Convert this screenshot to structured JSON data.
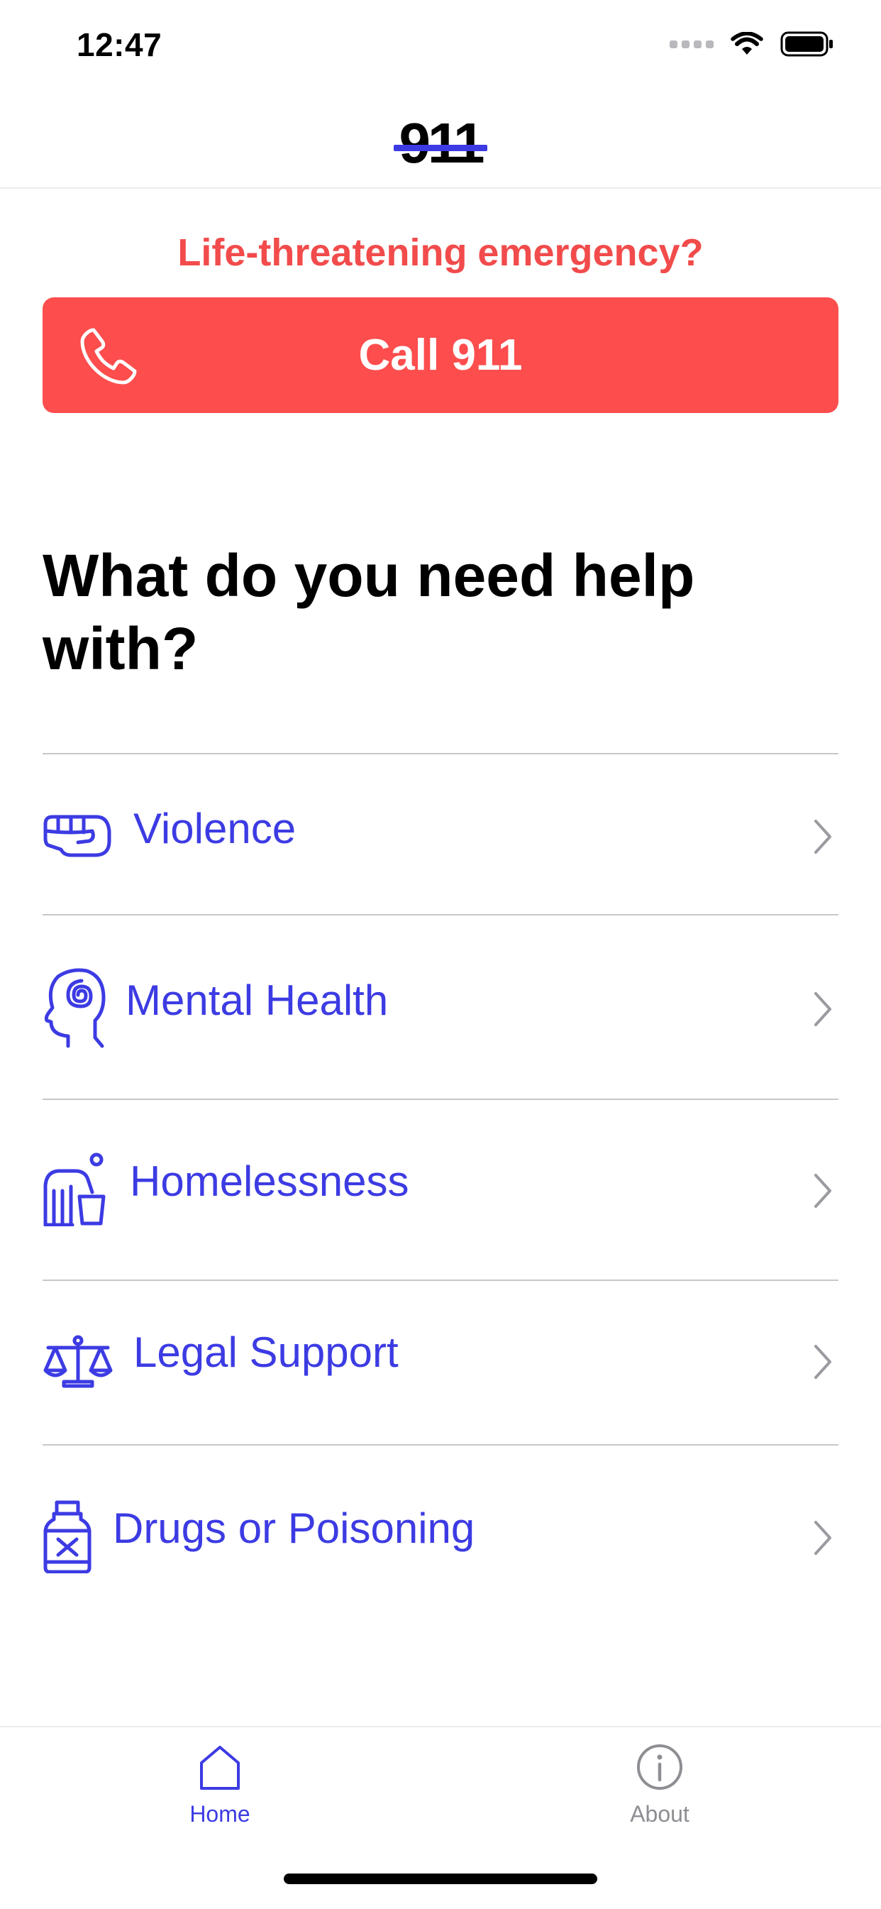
{
  "status_bar": {
    "time": "12:47"
  },
  "header": {
    "logo_text": "911"
  },
  "emergency": {
    "question": "Life-threatening emergency?",
    "call_label": "Call 911",
    "accent_color": "#fd4d4d"
  },
  "section_title": "What do you need help with?",
  "help_items": [
    {
      "label": "Violence",
      "icon": "fist-icon"
    },
    {
      "label": "Mental Health",
      "icon": "head-spiral-icon"
    },
    {
      "label": "Homelessness",
      "icon": "homeless-person-icon"
    },
    {
      "label": "Legal Support",
      "icon": "scales-icon"
    },
    {
      "label": "Drugs or Poisoning",
      "icon": "poison-bottle-icon"
    }
  ],
  "tab_bar": {
    "tabs": [
      {
        "label": "Home",
        "icon": "home-icon",
        "active": true
      },
      {
        "label": "About",
        "icon": "info-icon",
        "active": false
      }
    ],
    "active_color": "#3c3be3",
    "inactive_color": "#8e8e93"
  },
  "colors": {
    "brand": "#3c3be3",
    "emergency": "#f24b4b"
  }
}
